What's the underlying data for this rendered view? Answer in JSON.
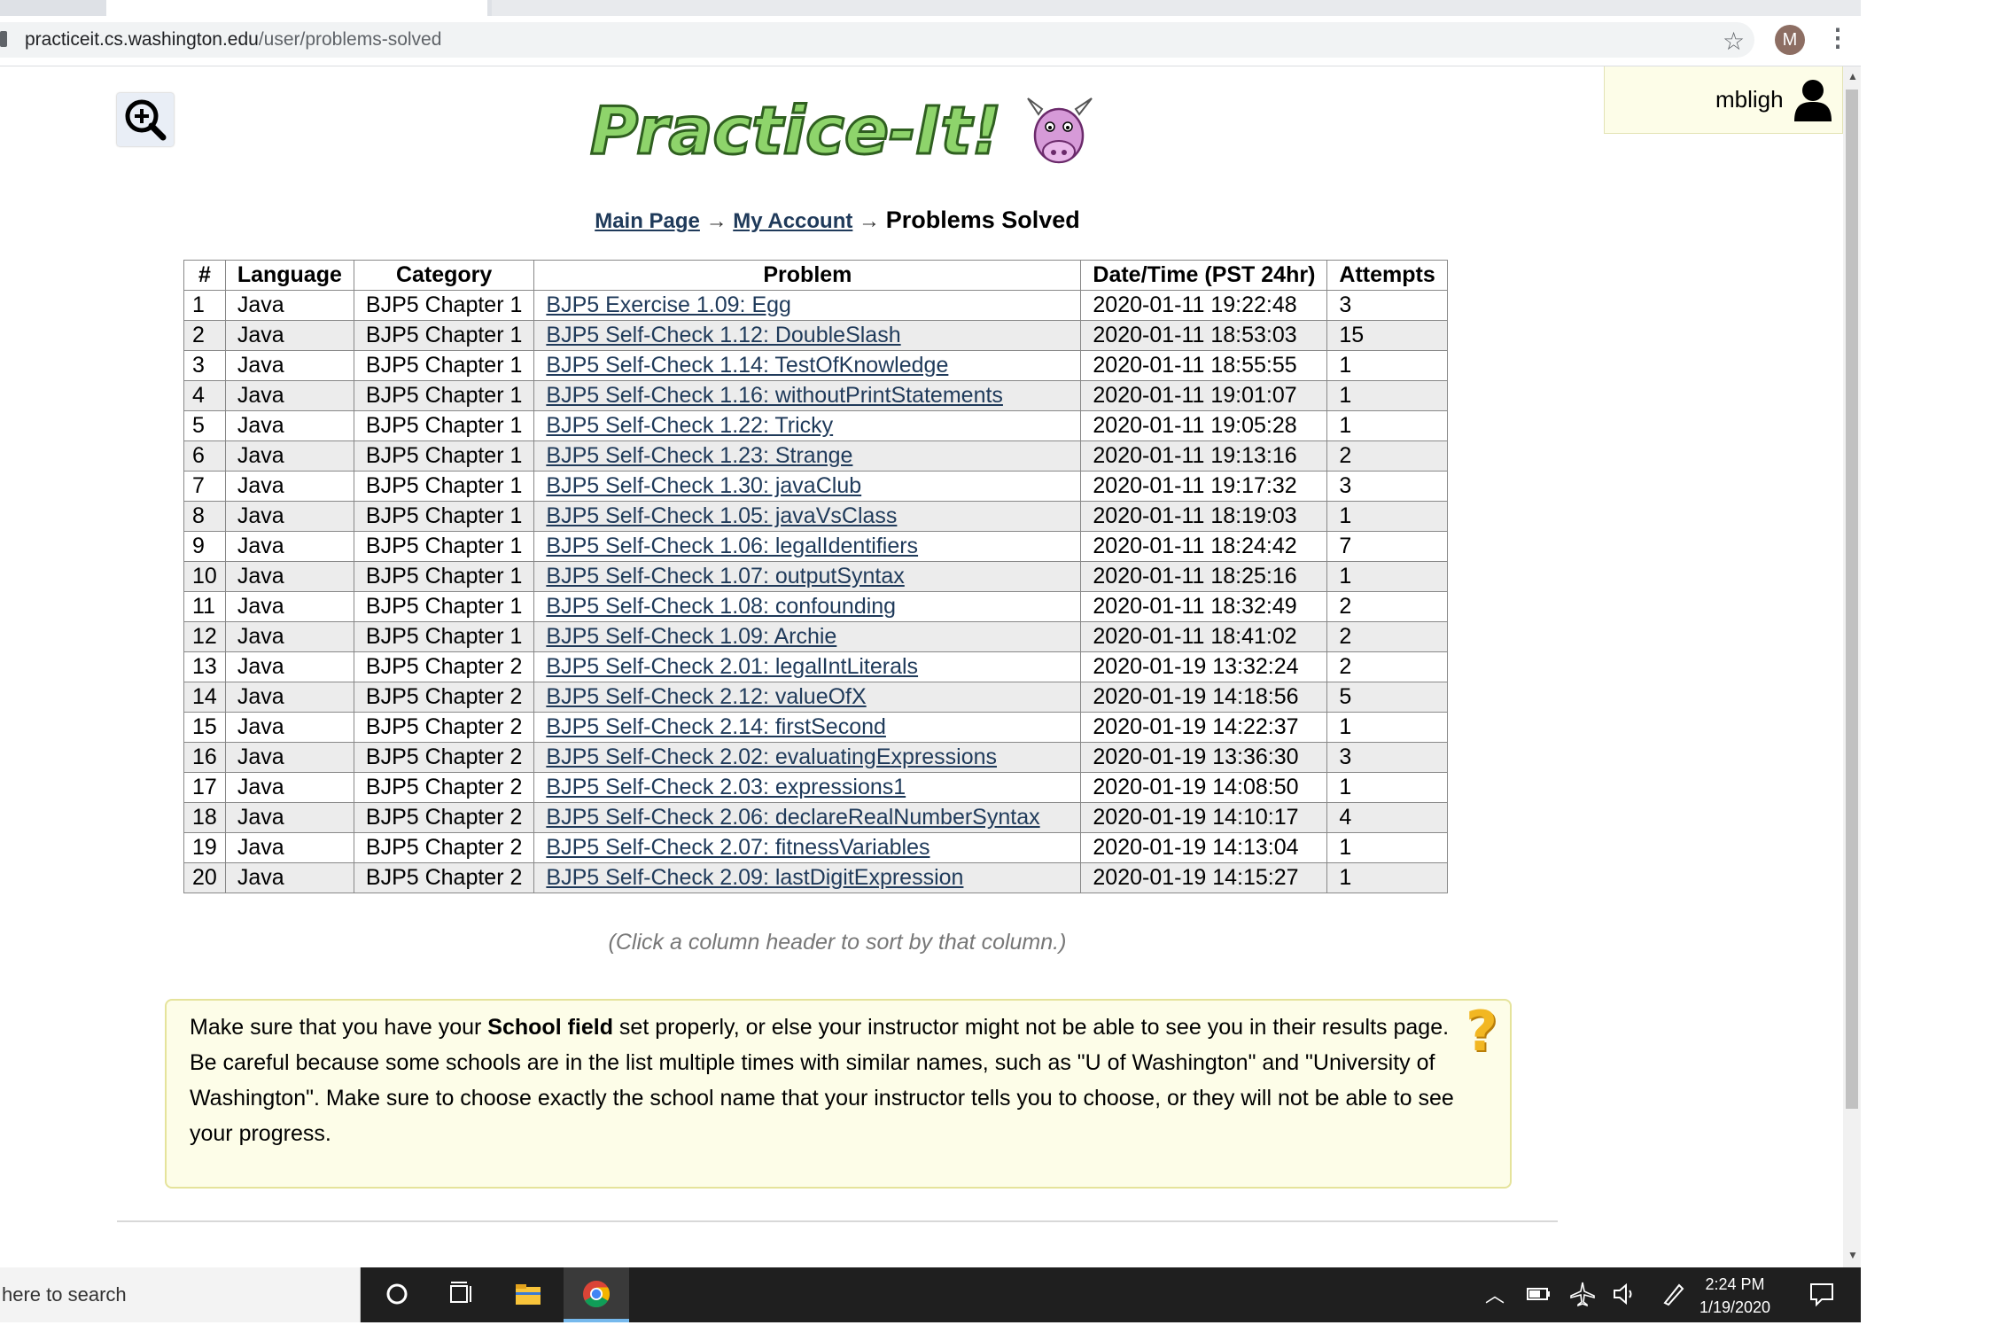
{
  "browser": {
    "url_host": "practiceit.cs.washington.edu",
    "url_path": "/user/problems-solved",
    "avatar_letter": "M"
  },
  "header": {
    "username": "mbligh",
    "logo_alt": "Practice-It!"
  },
  "breadcrumb": {
    "main_page": "Main Page",
    "my_account": "My Account",
    "arrow": "→",
    "current": "Problems Solved"
  },
  "table": {
    "headers": [
      "#",
      "Language",
      "Category",
      "Problem",
      "Date/Time (PST 24hr)",
      "Attempts"
    ],
    "rows": [
      {
        "n": "1",
        "lang": "Java",
        "cat": "BJP5 Chapter 1",
        "problem": "BJP5 Exercise 1.09: Egg",
        "date": "2020-01-11 19:22:48",
        "attempts": "3"
      },
      {
        "n": "2",
        "lang": "Java",
        "cat": "BJP5 Chapter 1",
        "problem": "BJP5 Self-Check 1.12: DoubleSlash",
        "date": "2020-01-11 18:53:03",
        "attempts": "15"
      },
      {
        "n": "3",
        "lang": "Java",
        "cat": "BJP5 Chapter 1",
        "problem": "BJP5 Self-Check 1.14: TestOfKnowledge",
        "date": "2020-01-11 18:55:55",
        "attempts": "1"
      },
      {
        "n": "4",
        "lang": "Java",
        "cat": "BJP5 Chapter 1",
        "problem": "BJP5 Self-Check 1.16: withoutPrintStatements",
        "date": "2020-01-11 19:01:07",
        "attempts": "1"
      },
      {
        "n": "5",
        "lang": "Java",
        "cat": "BJP5 Chapter 1",
        "problem": "BJP5 Self-Check 1.22: Tricky",
        "date": "2020-01-11 19:05:28",
        "attempts": "1"
      },
      {
        "n": "6",
        "lang": "Java",
        "cat": "BJP5 Chapter 1",
        "problem": "BJP5 Self-Check 1.23: Strange",
        "date": "2020-01-11 19:13:16",
        "attempts": "2"
      },
      {
        "n": "7",
        "lang": "Java",
        "cat": "BJP5 Chapter 1",
        "problem": "BJP5 Self-Check 1.30: javaClub",
        "date": "2020-01-11 19:17:32",
        "attempts": "3"
      },
      {
        "n": "8",
        "lang": "Java",
        "cat": "BJP5 Chapter 1",
        "problem": "BJP5 Self-Check 1.05: javaVsClass",
        "date": "2020-01-11 18:19:03",
        "attempts": "1"
      },
      {
        "n": "9",
        "lang": "Java",
        "cat": "BJP5 Chapter 1",
        "problem": "BJP5 Self-Check 1.06: legalIdentifiers",
        "date": "2020-01-11 18:24:42",
        "attempts": "7"
      },
      {
        "n": "10",
        "lang": "Java",
        "cat": "BJP5 Chapter 1",
        "problem": "BJP5 Self-Check 1.07: outputSyntax",
        "date": "2020-01-11 18:25:16",
        "attempts": "1"
      },
      {
        "n": "11",
        "lang": "Java",
        "cat": "BJP5 Chapter 1",
        "problem": "BJP5 Self-Check 1.08: confounding",
        "date": "2020-01-11 18:32:49",
        "attempts": "2"
      },
      {
        "n": "12",
        "lang": "Java",
        "cat": "BJP5 Chapter 1",
        "problem": "BJP5 Self-Check 1.09: Archie",
        "date": "2020-01-11 18:41:02",
        "attempts": "2"
      },
      {
        "n": "13",
        "lang": "Java",
        "cat": "BJP5 Chapter 2",
        "problem": "BJP5 Self-Check 2.01: legalIntLiterals",
        "date": "2020-01-19 13:32:24",
        "attempts": "2"
      },
      {
        "n": "14",
        "lang": "Java",
        "cat": "BJP5 Chapter 2",
        "problem": "BJP5 Self-Check 2.12: valueOfX",
        "date": "2020-01-19 14:18:56",
        "attempts": "5"
      },
      {
        "n": "15",
        "lang": "Java",
        "cat": "BJP5 Chapter 2",
        "problem": "BJP5 Self-Check 2.14: firstSecond",
        "date": "2020-01-19 14:22:37",
        "attempts": "1"
      },
      {
        "n": "16",
        "lang": "Java",
        "cat": "BJP5 Chapter 2",
        "problem": "BJP5 Self-Check 2.02: evaluatingExpressions",
        "date": "2020-01-19 13:36:30",
        "attempts": "3"
      },
      {
        "n": "17",
        "lang": "Java",
        "cat": "BJP5 Chapter 2",
        "problem": "BJP5 Self-Check 2.03: expressions1",
        "date": "2020-01-19 14:08:50",
        "attempts": "1"
      },
      {
        "n": "18",
        "lang": "Java",
        "cat": "BJP5 Chapter 2",
        "problem": "BJP5 Self-Check 2.06: declareRealNumberSyntax",
        "date": "2020-01-19 14:10:17",
        "attempts": "4"
      },
      {
        "n": "19",
        "lang": "Java",
        "cat": "BJP5 Chapter 2",
        "problem": "BJP5 Self-Check 2.07: fitnessVariables",
        "date": "2020-01-19 14:13:04",
        "attempts": "1"
      },
      {
        "n": "20",
        "lang": "Java",
        "cat": "BJP5 Chapter 2",
        "problem": "BJP5 Self-Check 2.09: lastDigitExpression",
        "date": "2020-01-19 14:15:27",
        "attempts": "1"
      }
    ]
  },
  "sort_hint": "(Click a column header to sort by that column.)",
  "notice": {
    "before": "Make sure that you have your ",
    "bold": "School field",
    "after": " set properly, or else your instructor might not be able to see you in their results page. Be careful because some schools are in the list multiple times with similar names, such as \"U of Washington\" and \"University of Washington\". Make sure to choose exactly the school name that your instructor tells you to choose, or they will not be able to see your progress.",
    "icon": "question-mark-icon"
  },
  "taskbar": {
    "search_text": "here to search",
    "time": "2:24 PM",
    "date": "1/19/2020"
  },
  "colors": {
    "link": "#1f3a5a",
    "notice_bg": "#fdfde8",
    "notice_border": "#e5e39b",
    "row_alt": "#ececec"
  }
}
